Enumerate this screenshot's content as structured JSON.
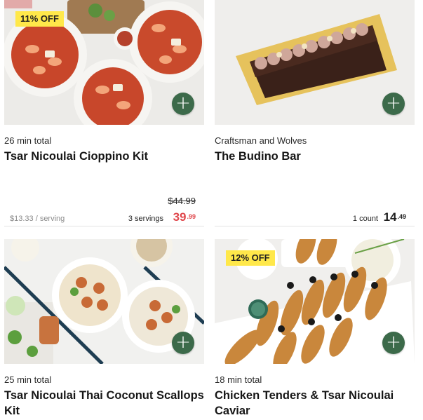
{
  "cards": [
    {
      "badge": "11% OFF",
      "meta": "26 min total",
      "title": "Tsar Nicoulai Cioppino Kit",
      "per_serving": "$13.33 / serving",
      "original_price": "$44.99",
      "quantity": "3 servings",
      "price_dollars": "39",
      "price_cents": ".99",
      "price_color": "#e0474c",
      "add_icon": "plus-icon"
    },
    {
      "badge": "",
      "meta": "Craftsman and Wolves",
      "title": "The Budino Bar",
      "per_serving": "",
      "original_price": "",
      "quantity": "1 count",
      "price_dollars": "14",
      "price_cents": ".49",
      "price_color": "#1f1f1f",
      "add_icon": "plus-icon"
    },
    {
      "badge": "",
      "meta": "25 min total",
      "title": "Tsar Nicoulai Thai Coconut Scallops Kit",
      "add_icon": "plus-icon"
    },
    {
      "badge": "12% OFF",
      "meta": "18 min total",
      "title": "Chicken Tenders & Tsar Nicoulai Caviar",
      "add_icon": "plus-icon"
    }
  ],
  "colors": {
    "add_button": "#3c6a4a",
    "badge": "#ffe84a",
    "sale_price": "#e0474c"
  }
}
